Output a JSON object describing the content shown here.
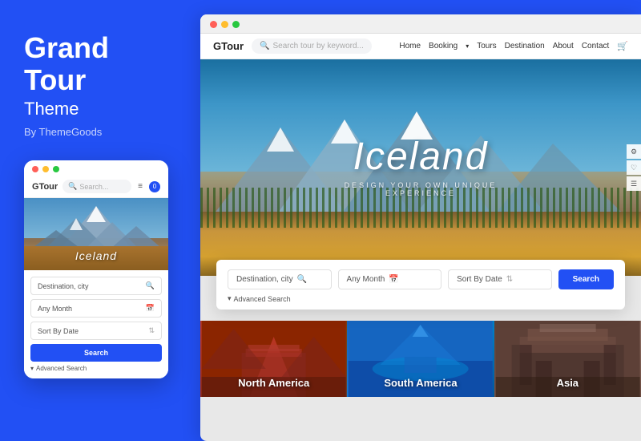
{
  "left": {
    "title": "Grand\nTour",
    "subtitle": "Theme",
    "by": "By ThemeGoods",
    "mobile": {
      "logo_g": "G",
      "logo_text": "Tour",
      "search_placeholder": "Search...",
      "hero_text": "Iceland",
      "field_destination": "Destination, city",
      "field_month": "Any Month",
      "field_sort": "Sort By Date",
      "search_btn": "Search",
      "advanced_label": "Advanced Search"
    }
  },
  "browser": {
    "website": {
      "logo_g": "G",
      "logo_text": "Tour",
      "search_placeholder": "Search tour by keyword...",
      "nav_links": [
        "Home",
        "Booking",
        "Tours",
        "Destination",
        "About",
        "Contact"
      ],
      "hero_title": "Iceland",
      "hero_subtitle": "Design Your Own Unique Experience",
      "search_destination": "Destination, city",
      "search_month": "Any Month",
      "search_sort": "Sort By Date",
      "search_btn": "Search",
      "advanced_label": "Advanced Search",
      "destinations": [
        {
          "label": "North America"
        },
        {
          "label": "South America"
        },
        {
          "label": "Asia"
        }
      ]
    }
  },
  "icons": {
    "search": "🔍",
    "calendar": "📅",
    "sort": "⇅",
    "menu": "≡",
    "cart": "🛒",
    "chevron_down": "▾",
    "chevron": "›",
    "settings": "⚙",
    "heart": "♡",
    "list": "☰"
  }
}
